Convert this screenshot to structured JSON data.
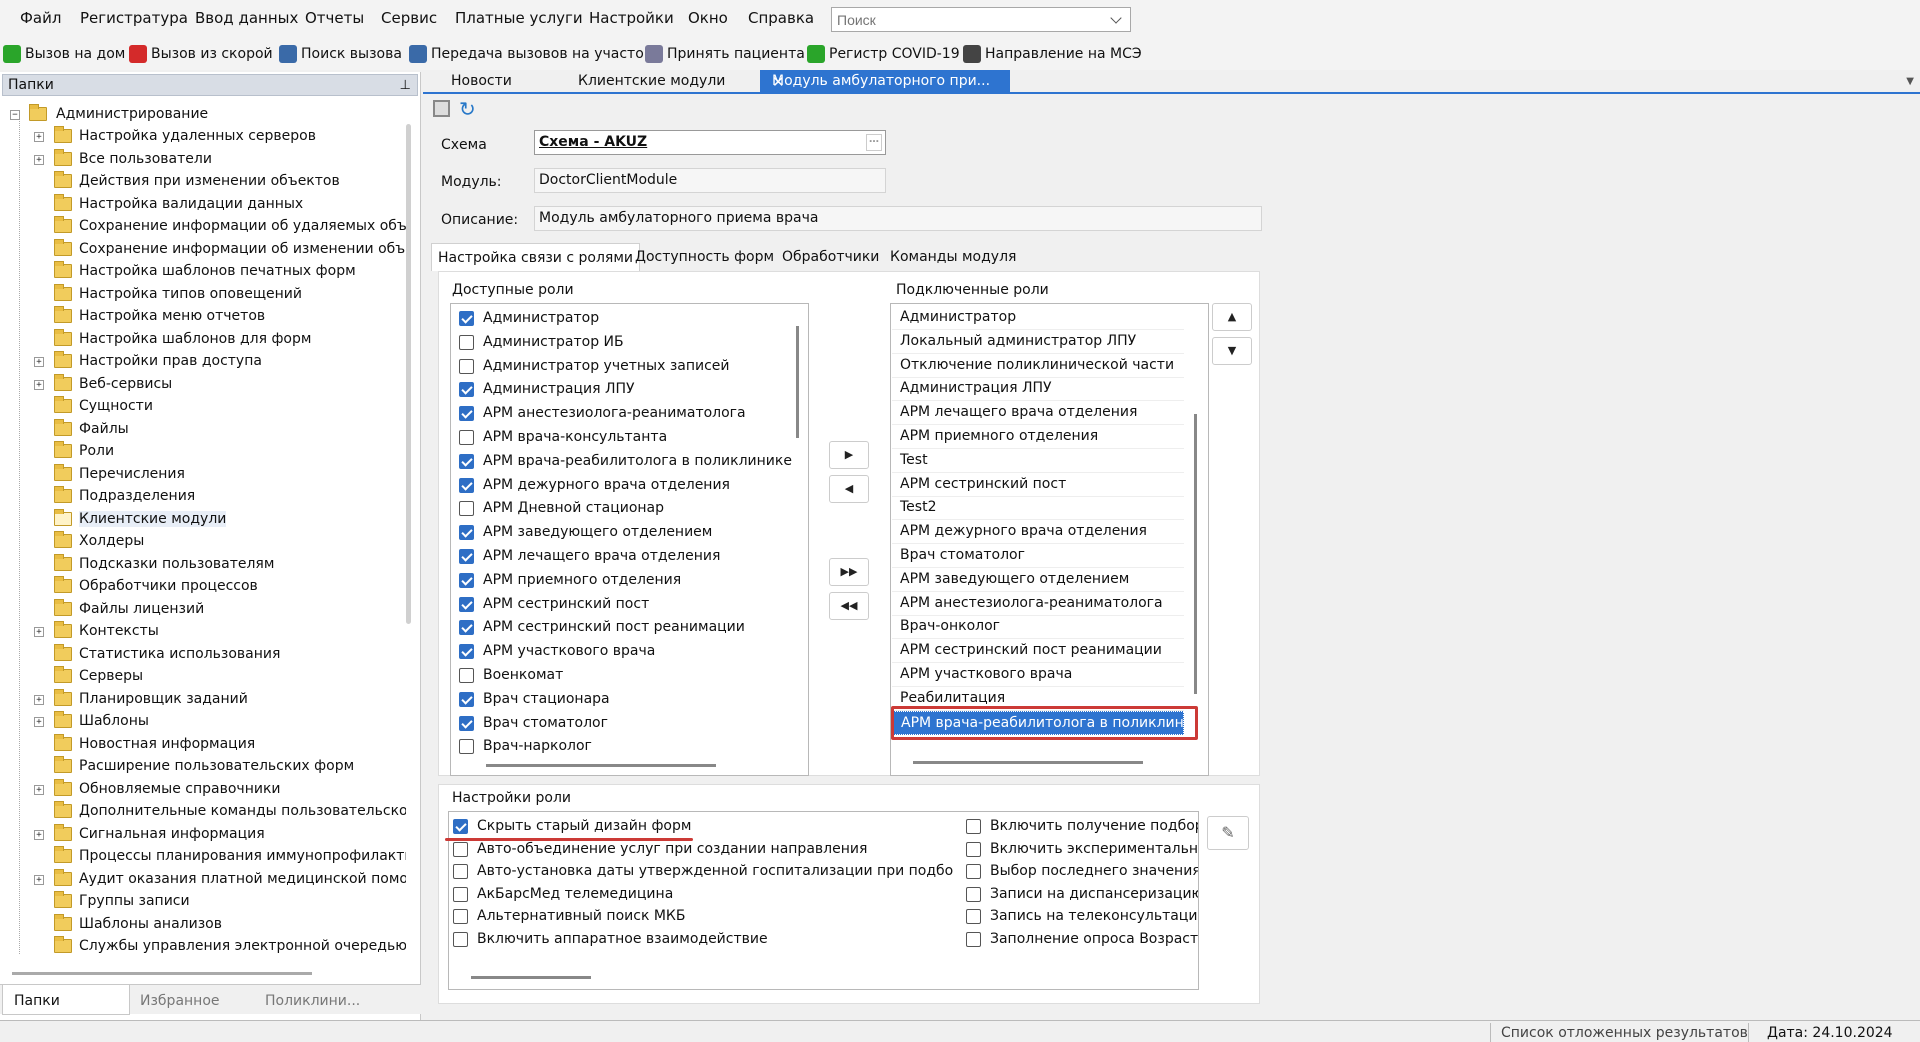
{
  "menu": [
    "Файл",
    "Регистратура",
    "Ввод данных",
    "Отчеты",
    "Сервис",
    "Платные услуги",
    "Настройки",
    "Окно",
    "Справка"
  ],
  "search": {
    "placeholder": "Поиск"
  },
  "toolbar": [
    {
      "label": "Вызов на дом",
      "icon": "green-check-icon"
    },
    {
      "label": "Вызов из скорой",
      "icon": "red-check-icon"
    },
    {
      "label": "Поиск вызова",
      "icon": "search-call-icon"
    },
    {
      "label": "Передача вызовов на участок",
      "icon": "transfer-icon"
    },
    {
      "label": "Принять пациента",
      "icon": "accept-patient-icon"
    },
    {
      "label": "Регистр COVID-19",
      "icon": "covid-icon"
    },
    {
      "label": "Направление на МСЭ",
      "icon": "referral-icon"
    }
  ],
  "left_panel": {
    "title": "Папки",
    "tree_root": "Администрирование",
    "tree": [
      {
        "label": "Настройка удаленных серверов",
        "exp": true
      },
      {
        "label": "Все пользователи",
        "exp": true
      },
      {
        "label": "Действия при изменении объектов",
        "exp": false
      },
      {
        "label": "Настройка валидации данных",
        "exp": false
      },
      {
        "label": "Сохранение информации об удаляемых объе",
        "exp": false
      },
      {
        "label": "Сохранение информации об изменении объе",
        "exp": false
      },
      {
        "label": "Настройка шаблонов печатных форм",
        "exp": false
      },
      {
        "label": "Настройка типов оповещений",
        "exp": false
      },
      {
        "label": "Настройка меню отчетов",
        "exp": false
      },
      {
        "label": "Настройка шаблонов для форм",
        "exp": false
      },
      {
        "label": "Настройки прав доступа",
        "exp": true
      },
      {
        "label": "Веб-сервисы",
        "exp": true
      },
      {
        "label": "Сущности",
        "exp": false
      },
      {
        "label": "Файлы",
        "exp": false
      },
      {
        "label": "Роли",
        "exp": false
      },
      {
        "label": "Перечисления",
        "exp": false
      },
      {
        "label": "Подразделения",
        "exp": false
      },
      {
        "label": "Клиентские модули",
        "exp": false,
        "selected": true
      },
      {
        "label": "Холдеры",
        "exp": false
      },
      {
        "label": "Подсказки пользователям",
        "exp": false
      },
      {
        "label": "Обработчики процессов",
        "exp": false
      },
      {
        "label": "Файлы лицензий",
        "exp": false
      },
      {
        "label": "Контексты",
        "exp": true
      },
      {
        "label": "Статистика использования",
        "exp": false
      },
      {
        "label": "Серверы",
        "exp": false
      },
      {
        "label": "Планировщик заданий",
        "exp": true
      },
      {
        "label": "Шаблоны",
        "exp": true
      },
      {
        "label": "Новостная информация",
        "exp": false
      },
      {
        "label": "Расширение пользовательских форм",
        "exp": false
      },
      {
        "label": "Обновляемые справочники",
        "exp": true
      },
      {
        "label": "Дополнительные команды пользовательского",
        "exp": false
      },
      {
        "label": "Сигнальная информация",
        "exp": true
      },
      {
        "label": "Процессы планирования иммунопрофилакти",
        "exp": false
      },
      {
        "label": "Аудит оказания платной медицинской помощ",
        "exp": true
      },
      {
        "label": "Группы записи",
        "exp": false
      },
      {
        "label": "Шаблоны анализов",
        "exp": false
      },
      {
        "label": "Службы управления электронной очередью",
        "exp": false
      }
    ],
    "tabs": [
      "Папки",
      "Избранное",
      "Поликлини..."
    ]
  },
  "doc_tabs": {
    "items": [
      "Новости",
      "Клиентские модули"
    ],
    "active": "Модуль амбулаторного при..."
  },
  "form": {
    "schema_label": "Схема",
    "schema_value": "Схема - AKUZ",
    "module_label": "Модуль:",
    "module_value": "DoctorClientModule",
    "desc_label": "Описание:",
    "desc_value": "Модуль амбулаторного приема врача"
  },
  "inner_tabs": [
    "Настройка связи с ролями",
    "Доступность форм",
    "Обработчики",
    "Команды модуля"
  ],
  "available_roles": {
    "title": "Доступные роли",
    "items": [
      {
        "label": "Администратор",
        "checked": true
      },
      {
        "label": "Администратор ИБ",
        "checked": false
      },
      {
        "label": "Администратор учетных записей",
        "checked": false
      },
      {
        "label": "Администрация ЛПУ",
        "checked": true
      },
      {
        "label": "АРМ анестезиолога-реаниматолога",
        "checked": true
      },
      {
        "label": "АРМ врача-консультанта",
        "checked": false
      },
      {
        "label": "АРМ врача-реабилитолога в поликлинике",
        "checked": true
      },
      {
        "label": "АРМ дежурного врача отделения",
        "checked": true
      },
      {
        "label": "АРМ Дневной стационар",
        "checked": false
      },
      {
        "label": "АРМ заведующего отделением",
        "checked": true
      },
      {
        "label": "АРМ лечащего врача отделения",
        "checked": true
      },
      {
        "label": "АРМ приемного отделения",
        "checked": true
      },
      {
        "label": "АРМ сестринский пост",
        "checked": true
      },
      {
        "label": "АРМ сестринский пост реанимации",
        "checked": true
      },
      {
        "label": "АРМ участкового врача",
        "checked": true
      },
      {
        "label": "Военкомат",
        "checked": false
      },
      {
        "label": "Врач стационара",
        "checked": true
      },
      {
        "label": "Врач стоматолог",
        "checked": true
      },
      {
        "label": "Врач-нарколог",
        "checked": false
      }
    ]
  },
  "connected_roles": {
    "title": "Подключенные роли",
    "items": [
      "Администратор",
      "Локальный администратор ЛПУ",
      "Отключение поликлинической части",
      "Администрация ЛПУ",
      "АРМ лечащего врача отделения",
      "АРМ приемного отделения",
      "Test",
      "АРМ сестринский пост",
      "Test2",
      "АРМ дежурного врача отделения",
      "Врач стоматолог",
      "АРМ заведующего отделением",
      "АРМ анестезиолога-реаниматолога",
      "Врач-онколог",
      "АРМ сестринский пост реанимации",
      "АРМ участкового врача",
      "Реабилитация",
      "АРМ врача-реабилитолога в поликлиник"
    ],
    "selected_index": 17
  },
  "role_settings": {
    "title": "Настройки роли",
    "left": [
      {
        "label": "Скрыть старый дизайн форм",
        "checked": true
      },
      {
        "label": "Авто-объединение услуг при создании направления",
        "checked": false
      },
      {
        "label": "Авто-установка даты утвержденной госпитализации при подборе",
        "checked": false
      },
      {
        "label": "АкБарсМед телемедицина",
        "checked": false
      },
      {
        "label": "Альтернативный поиск МКБ",
        "checked": false
      },
      {
        "label": "Включить аппаратное взаимодействие",
        "checked": false
      }
    ],
    "right": [
      {
        "label": "Включить получение подборс",
        "checked": false
      },
      {
        "label": "Включить экспериментальны",
        "checked": false
      },
      {
        "label": "Выбор последнего значения н",
        "checked": false
      },
      {
        "label": "Записи на диспансеризацию",
        "checked": false
      },
      {
        "label": "Запись на телеконсультацию і",
        "checked": false
      },
      {
        "label": "Заполнение опроса Возраст н",
        "checked": false
      }
    ]
  },
  "status": {
    "pending": "Список отложенных результатов",
    "date": "Дата: 24.10.2024"
  },
  "colors": {
    "accent": "#2e74d0",
    "highlight": "#cc3a36"
  }
}
